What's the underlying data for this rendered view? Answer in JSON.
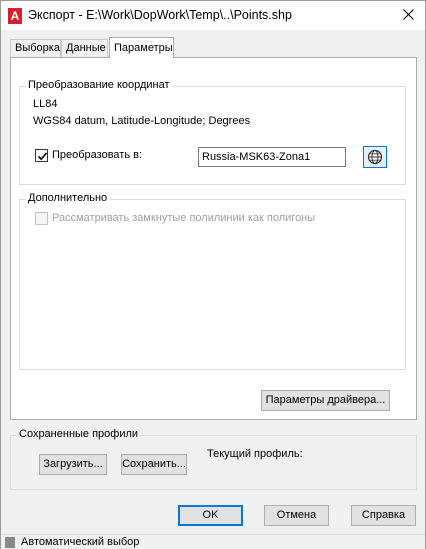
{
  "window": {
    "title": "Экспорт - E:\\Work\\DopWork\\Temp\\..\\Points.shp",
    "app_icon_letter": "A"
  },
  "tabs": [
    {
      "label": "Выборка",
      "active": false
    },
    {
      "label": "Данные",
      "active": false
    },
    {
      "label": "Параметры",
      "active": true
    }
  ],
  "coord_transform": {
    "group_title": "Преобразование координат",
    "code": "LL84",
    "description": "WGS84 datum, Latitude-Longitude; Degrees",
    "convert_checkbox_label": "Преобразовать в:",
    "convert_checked": true,
    "target_cs": "Russia-MSK63-Zona1"
  },
  "additional": {
    "group_title": "Дополнительно",
    "closed_polylines_label": "Рассматривать замкнутые полилинии как полигоны",
    "closed_polylines_checked": false,
    "closed_polylines_enabled": false
  },
  "driver_params_button": "Параметры драйвера...",
  "profiles": {
    "group_title": "Сохраненные профили",
    "load_button": "Загрузить...",
    "save_button": "Сохранить...",
    "current_profile_label": "Текущий профиль:"
  },
  "dialog_buttons": {
    "ok": "OK",
    "cancel": "Отмена",
    "help": "Справка"
  },
  "status_bar": {
    "text": "Автоматический выбор"
  },
  "colors": {
    "accent": "#0078d7",
    "app_icon": "#d8202a"
  }
}
